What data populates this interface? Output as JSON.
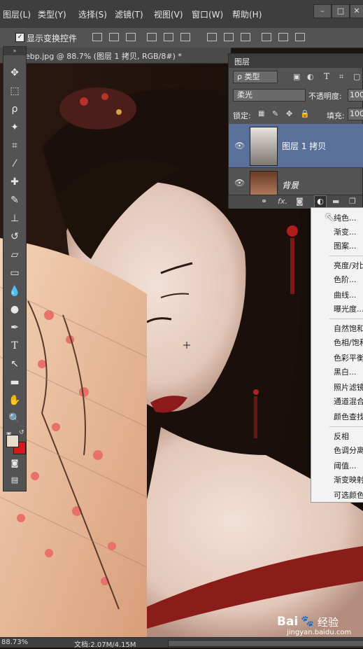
{
  "menubar": {
    "items": [
      "图层(L)",
      "类型(Y)",
      "选择(S)",
      "滤镜(T)",
      "视图(V)",
      "窗口(W)",
      "帮助(H)"
    ]
  },
  "options": {
    "show_transform": "显示变换控件"
  },
  "document": {
    "tab_title": "ebp.jpg @ 88.7% (图层 1 拷贝, RGB/8#) *"
  },
  "layers_panel": {
    "title": "图层",
    "filter_kind": "ρ 类型",
    "blend_mode": "柔光",
    "opacity_label": "不透明度:",
    "opacity_value": "100",
    "lock_label": "锁定:",
    "fill_label": "填充:",
    "fill_value": "100",
    "layers": [
      {
        "name": "图层 1 拷贝",
        "selected": true
      },
      {
        "name": "背景",
        "selected": false
      }
    ],
    "footer_icons": [
      "link-icon",
      "fx-icon",
      "mask-icon",
      "adjustment-icon",
      "folder-icon",
      "new-layer-icon"
    ],
    "fx_label": "fx."
  },
  "adjustment_menu": {
    "items": [
      "纯色...",
      "渐变...",
      "图案...",
      "亮度/对比",
      "色阶...",
      "曲线...",
      "曝光度...",
      "自然饱和",
      "色相/饱和",
      "色彩平衡",
      "黑白...",
      "照片滤镜",
      "通道混合",
      "颜色查找",
      "反相",
      "色调分离",
      "阈值...",
      "渐变映射",
      "可选颜色"
    ]
  },
  "status": {
    "zoom": "88.73%",
    "doc_info": "文档:2.07M/4.15M"
  },
  "watermark": {
    "brand": "Bai",
    "brand2": "经验",
    "url": "jingyan.baidu.com"
  },
  "colors": {
    "foreground": "#e8dccb",
    "background": "#d81818",
    "panel": "#535353",
    "selected_layer": "#58709a"
  }
}
